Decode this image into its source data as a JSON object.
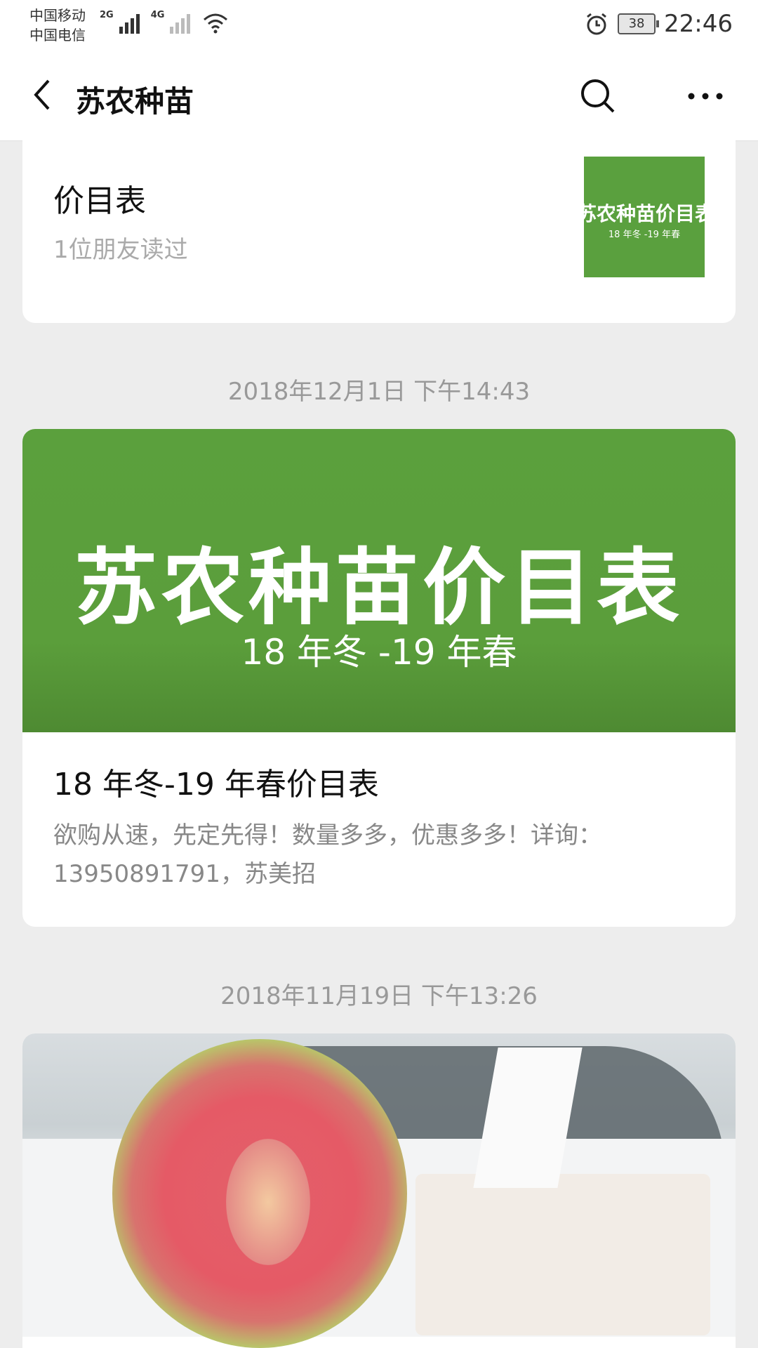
{
  "status_bar": {
    "carrier_1": "中国移动",
    "carrier_2": "中国电信",
    "network_1": "2G",
    "network_2": "4G",
    "battery": "38",
    "time": "22:46",
    "icons": [
      "signal-icon",
      "wifi-icon",
      "alarm-icon",
      "battery-icon"
    ]
  },
  "nav": {
    "title": "苏农种苗",
    "back_icon": "back-arrow-icon",
    "search_icon": "search-icon",
    "more_icon": "more-icon"
  },
  "articles": [
    {
      "title": "价目表",
      "read_info": "1位朋友读过",
      "thumb_title": "苏农种苗价目表",
      "thumb_subtitle": "18 年冬 -19 年春"
    },
    {
      "timestamp": "2018年12月1日 下午14:43",
      "banner_title": "苏农种苗价目表",
      "banner_subtitle": "18 年冬 -19 年春",
      "title": "18 年冬-19 年春价目表",
      "desc_line1": "欲购从速，先定先得！数量多多，优惠多多！详询：",
      "desc_line2": "13950891791，苏美招"
    },
    {
      "timestamp": "2018年11月19日 下午13:26"
    }
  ]
}
